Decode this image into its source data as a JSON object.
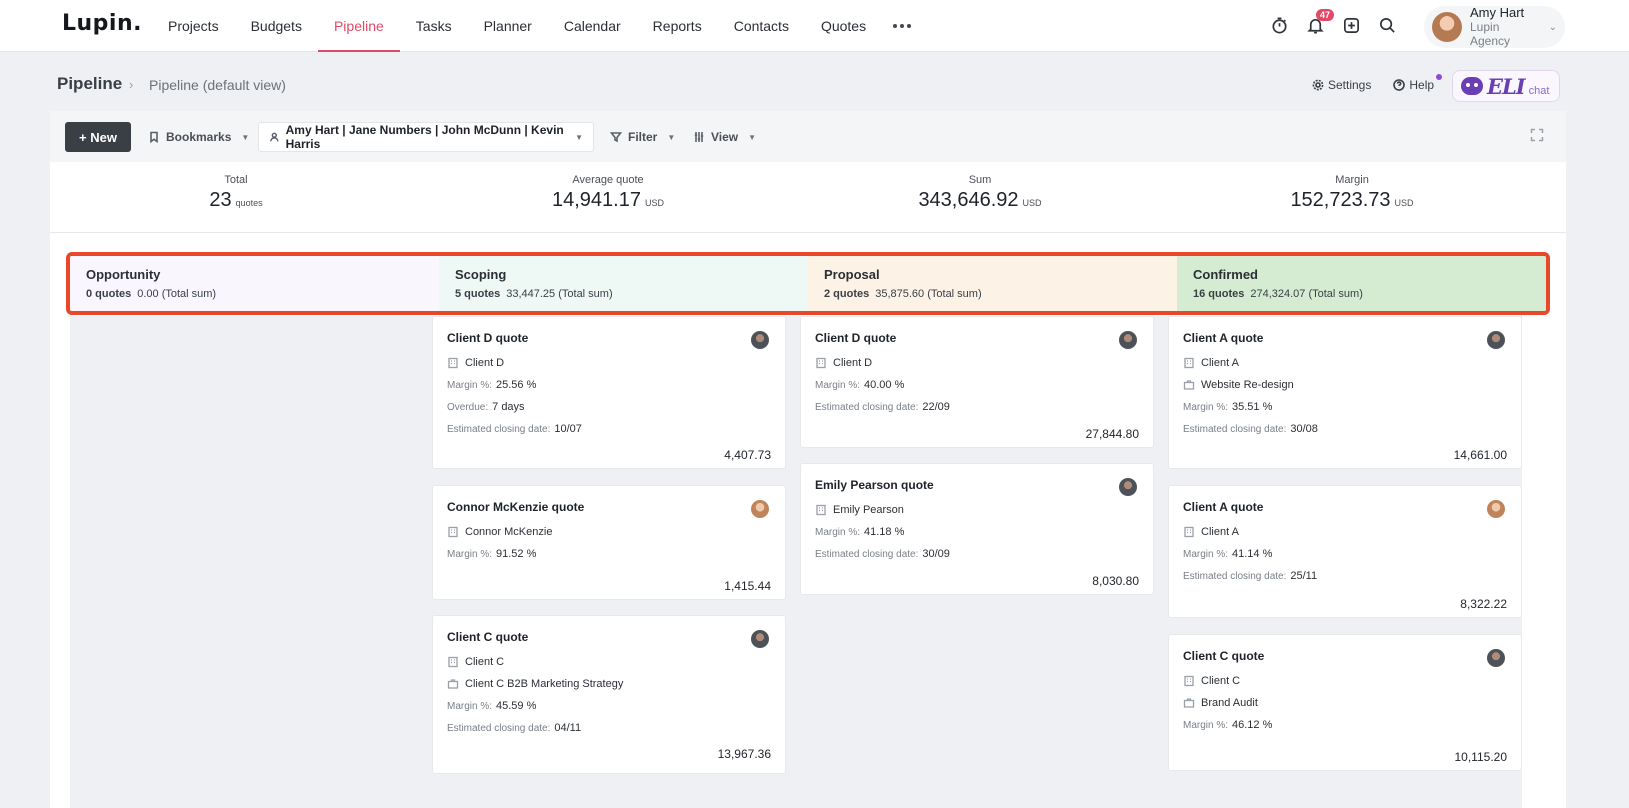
{
  "app": {
    "logo": "Lupin.",
    "nav": [
      "Projects",
      "Budgets",
      "Pipeline",
      "Tasks",
      "Planner",
      "Calendar",
      "Reports",
      "Contacts",
      "Quotes"
    ],
    "active_nav": "Pipeline",
    "notification_count": "47",
    "user": {
      "name": "Amy Hart",
      "org": "Lupin Agency"
    }
  },
  "header": {
    "title": "Pipeline",
    "breadcrumb": "Pipeline (default view)",
    "settings_label": "Settings",
    "help_label": "Help",
    "eli_label": "ELI",
    "eli_chat": "chat"
  },
  "toolbar": {
    "new_label": "+ New",
    "bookmarks_label": "Bookmarks",
    "people_filter": "Amy Hart | Jane Numbers | John McDunn | Kevin Harris",
    "filter_label": "Filter",
    "view_label": "View"
  },
  "stats": {
    "total": {
      "label": "Total",
      "value": "23",
      "unit": "quotes"
    },
    "average": {
      "label": "Average quote",
      "value": "14,941.17",
      "unit": "USD"
    },
    "sum": {
      "label": "Sum",
      "value": "343,646.92",
      "unit": "USD"
    },
    "margin": {
      "label": "Margin",
      "value": "152,723.73",
      "unit": "USD"
    }
  },
  "stages": [
    {
      "name": "Opportunity",
      "count": "0 quotes",
      "sum": "0.00 (Total sum)",
      "color": "#faf6fd"
    },
    {
      "name": "Scoping",
      "count": "5 quotes",
      "sum": "33,447.25 (Total sum)",
      "color": "#eef8f5"
    },
    {
      "name": "Proposal",
      "count": "2 quotes",
      "sum": "35,875.60 (Total sum)",
      "color": "#fdf2e6"
    },
    {
      "name": "Confirmed",
      "count": "16 quotes",
      "sum": "274,324.07 (Total sum)",
      "color": "#d6ecd2"
    }
  ],
  "labels": {
    "margin": "Margin %:",
    "overdue": "Overdue:",
    "closing": "Estimated closing date:"
  },
  "columns": {
    "scoping": [
      {
        "title": "Client D quote",
        "client": "Client D",
        "margin": "25.56 %",
        "overdue": "7 days",
        "closing": "10/07",
        "total": "4,407.73"
      },
      {
        "title": "Connor McKenzie quote",
        "client": "Connor McKenzie",
        "margin": "91.52 %",
        "total": "1,415.44"
      },
      {
        "title": "Client C quote",
        "client": "Client C",
        "project": "Client C B2B Marketing Strategy",
        "margin": "45.59 %",
        "closing": "04/11",
        "total": "13,967.36"
      }
    ],
    "proposal": [
      {
        "title": "Client D quote",
        "client": "Client D",
        "margin": "40.00 %",
        "closing": "22/09",
        "total": "27,844.80"
      },
      {
        "title": "Emily Pearson quote",
        "client": "Emily Pearson",
        "margin": "41.18 %",
        "closing": "30/09",
        "total": "8,030.80"
      }
    ],
    "confirmed": [
      {
        "title": "Client A quote",
        "client": "Client A",
        "project": "Website Re-design",
        "margin": "35.51 %",
        "closing": "30/08",
        "total": "14,661.00"
      },
      {
        "title": "Client A quote",
        "client": "Client A",
        "margin": "41.14 %",
        "closing": "25/11",
        "total": "8,322.22"
      },
      {
        "title": "Client C quote",
        "client": "Client C",
        "project": "Brand Audit",
        "margin": "46.12 %",
        "total": "10,115.20"
      }
    ]
  }
}
